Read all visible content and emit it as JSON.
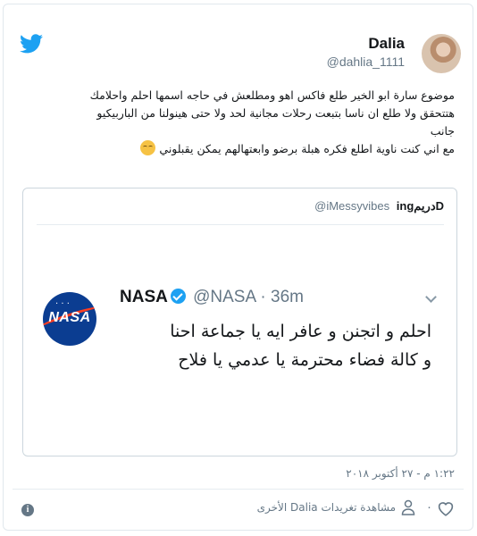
{
  "author": {
    "display_name": "Dalia",
    "handle": "@dahlia_1111"
  },
  "tweet": {
    "lines": [
      "موضوع سارة ابو الخير طلع فاكس اهو ومطلعش في حاجه اسمها احلم واحلامك",
      "هتتحقق ولا طلع ان ناسا بتبعت رحلات مجانية لحد ولا حتى هينولنا من الباربيكيو",
      "جانب",
      "مع اني كنت ناوية اطلع فكره هبلة برضو وابعتهالهم يمكن يقبلوني"
    ],
    "emoji": "pensive-face"
  },
  "quote": {
    "name": "ingدريمD",
    "handle": "@iMessyvibes",
    "embedded": {
      "logo_text": "NASA",
      "name": "NASA",
      "handle": "@NASA",
      "separator": "·",
      "time": "36m",
      "lines": [
        "احلم و اتجنن و عافر ايه يا جماعة احنا",
        "و كالة فضاء محترمة يا عدمي يا فلاح"
      ]
    }
  },
  "footer": {
    "timestamp": "١:٢٢ م - ٢٧ أكتوبر ٢٠١٨",
    "like_count": "٠",
    "more_tweets": "مشاهدة تغريدات Dalia الأخرى",
    "info_glyph": "i"
  },
  "colors": {
    "twitter_blue": "#1da1f2",
    "secondary_text": "#657786",
    "border": "#e1e8ed",
    "nasa_blue": "#0b3d91",
    "nasa_red": "#fc3d21"
  },
  "icons": [
    "twitter-bird-icon",
    "verified-badge-icon",
    "chevron-down-icon",
    "heart-icon",
    "person-icon",
    "info-icon"
  ]
}
